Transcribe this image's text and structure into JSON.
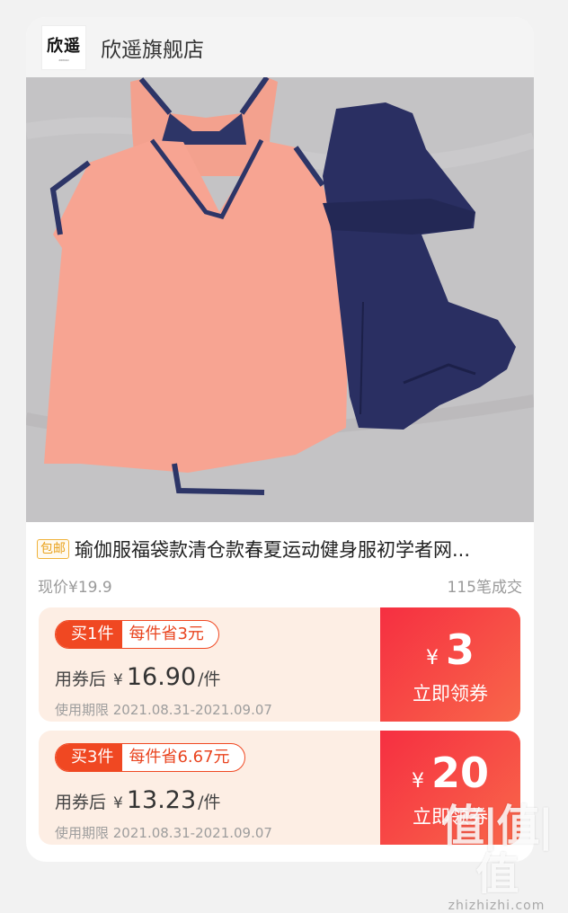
{
  "shop": {
    "logo_text": "欣遥",
    "logo_subtext": "XINYAO",
    "name": "欣遥旗舰店"
  },
  "product": {
    "image_label": "product-photo",
    "badge": "包邮",
    "title": "瑜伽服福袋款清仓款春夏运动健身服初学者网...",
    "current_price": "现价¥19.9",
    "sales": "115笔成交"
  },
  "coupons": [
    {
      "qty": "买1件",
      "save": "每件省3元",
      "after_label": "用券后",
      "currency": "¥",
      "after_price": "16.90",
      "unit": "/件",
      "period": "使用期限 2021.08.31-2021.09.07",
      "value_currency": "¥",
      "value": "3",
      "claim": "立即领券"
    },
    {
      "qty": "买3件",
      "save": "每件省6.67元",
      "after_label": "用券后",
      "currency": "¥",
      "after_price": "13.23",
      "unit": "/件",
      "period": "使用期限 2021.08.31-2021.09.07",
      "value_currency": "¥",
      "value": "20",
      "claim": "立即领券"
    }
  ],
  "watermark": {
    "main": "值|值|值",
    "url": "zhizhizhi.com"
  },
  "colors": {
    "accent": "#f04822",
    "coupon_bg": "#fdeee4",
    "coupon_right": "#f62f41"
  }
}
